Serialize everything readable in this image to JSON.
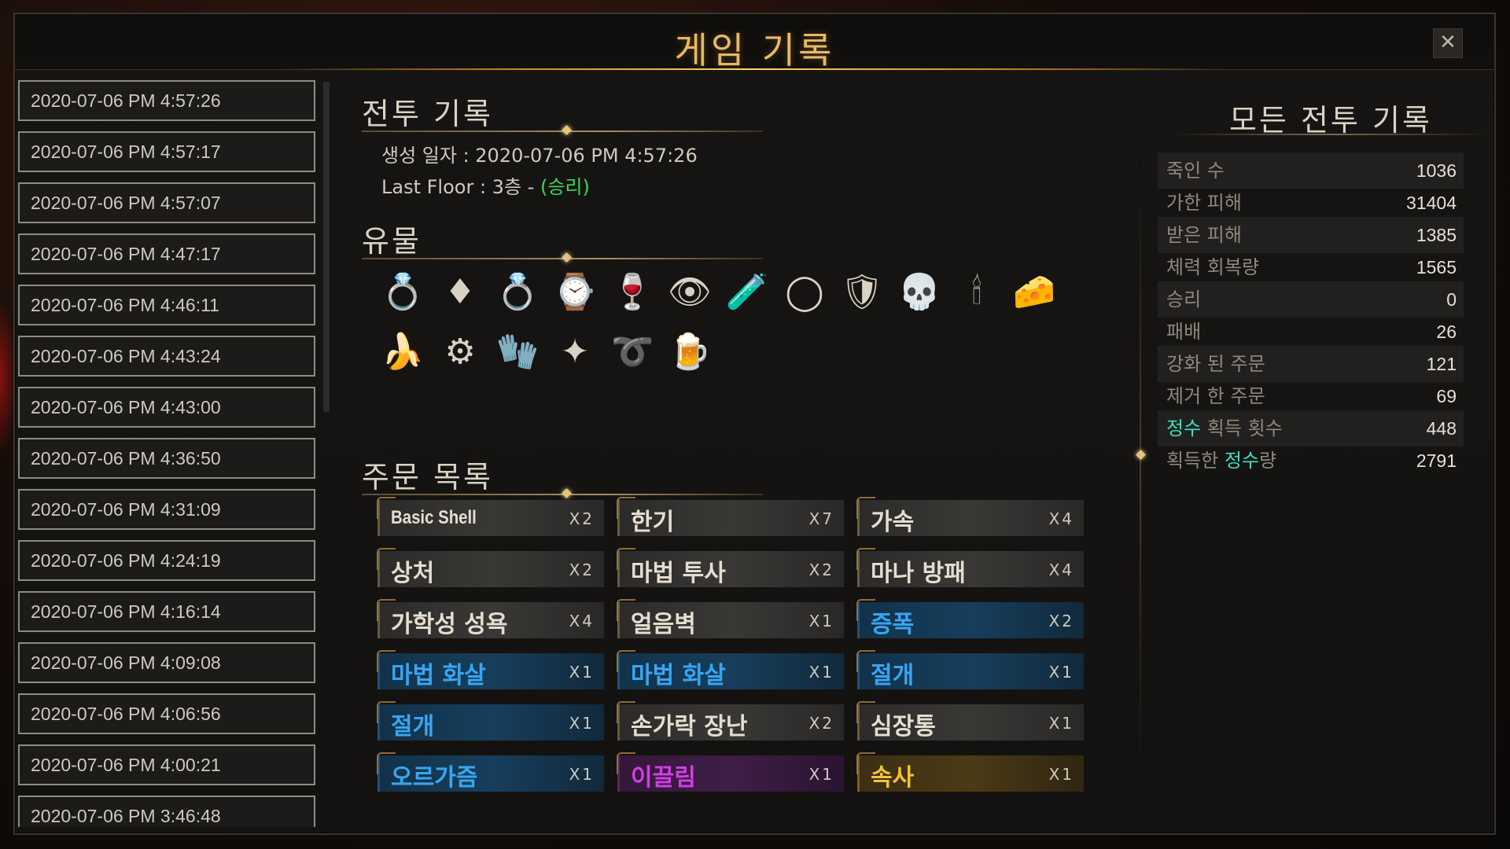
{
  "window": {
    "title": "게임 기록",
    "close_label": "✕"
  },
  "records": [
    "2020-07-06 PM 4:57:26",
    "2020-07-06 PM 4:57:17",
    "2020-07-06 PM 4:57:07",
    "2020-07-06 PM 4:47:17",
    "2020-07-06 PM 4:46:11",
    "2020-07-06 PM 4:43:24",
    "2020-07-06 PM 4:43:00",
    "2020-07-06 PM 4:36:50",
    "2020-07-06 PM 4:31:09",
    "2020-07-06 PM 4:24:19",
    "2020-07-06 PM 4:16:14",
    "2020-07-06 PM 4:09:08",
    "2020-07-06 PM 4:06:56",
    "2020-07-06 PM 4:00:21",
    "2020-07-06 PM 3:46:48"
  ],
  "battle": {
    "title": "전투 기록",
    "created_label": "생성 일자 : 2020-07-06 PM 4:57:26",
    "last_floor_label": "Last Floor : 3층 - ",
    "result": "(승리)"
  },
  "relics": {
    "title": "유물",
    "items": [
      {
        "icon": "silver-ring-icon",
        "glyph": "💍"
      },
      {
        "icon": "demon-emblem-icon",
        "glyph": "♦"
      },
      {
        "icon": "gem-ring-icon",
        "glyph": "💍"
      },
      {
        "icon": "pocket-watch-icon",
        "glyph": "⌚"
      },
      {
        "icon": "wine-glass-icon",
        "glyph": "🍷"
      },
      {
        "icon": "eye-staff-icon",
        "glyph": "👁"
      },
      {
        "icon": "potion-vial-icon",
        "glyph": "🧪"
      },
      {
        "icon": "purple-ring-icon",
        "glyph": "◯"
      },
      {
        "icon": "wooden-shield-icon",
        "glyph": "🛡"
      },
      {
        "icon": "skull-icon",
        "glyph": "💀"
      },
      {
        "icon": "candle-icon",
        "glyph": "🕯"
      },
      {
        "icon": "cheese-icon",
        "glyph": "🧀"
      },
      {
        "icon": "banana-icon",
        "glyph": "🍌"
      },
      {
        "icon": "gear-icon",
        "glyph": "⚙"
      },
      {
        "icon": "gauntlet-icon",
        "glyph": "🧤"
      },
      {
        "icon": "gold-ore-icon",
        "glyph": "✦"
      },
      {
        "icon": "rope-icon",
        "glyph": "➰"
      },
      {
        "icon": "mug-icon",
        "glyph": "🍺"
      }
    ]
  },
  "spells": {
    "title": "주문 목록",
    "items": [
      {
        "name": "Basic Shell",
        "count": "X2",
        "style": "gray",
        "en": true
      },
      {
        "name": "한기",
        "count": "X7",
        "style": "gray"
      },
      {
        "name": "가속",
        "count": "X4",
        "style": "gray"
      },
      {
        "name": "상처",
        "count": "X2",
        "style": "gray"
      },
      {
        "name": "마법 투사",
        "count": "X2",
        "style": "gray"
      },
      {
        "name": "마나 방패",
        "count": "X4",
        "style": "gray"
      },
      {
        "name": "가학성 성욕",
        "count": "X4",
        "style": "gray"
      },
      {
        "name": "얼음벽",
        "count": "X1",
        "style": "gray"
      },
      {
        "name": "증폭",
        "count": "X2",
        "style": "blue"
      },
      {
        "name": "마법 화살",
        "count": "X1",
        "style": "blue"
      },
      {
        "name": "마법 화살",
        "count": "X1",
        "style": "blue"
      },
      {
        "name": "절개",
        "count": "X1",
        "style": "blue"
      },
      {
        "name": "절개",
        "count": "X1",
        "style": "blue"
      },
      {
        "name": "손가락 장난",
        "count": "X2",
        "style": "gray"
      },
      {
        "name": "심장통",
        "count": "X1",
        "style": "gray"
      },
      {
        "name": "오르가즘",
        "count": "X1",
        "style": "blue"
      },
      {
        "name": "이끌림",
        "count": "X1",
        "style": "purple"
      },
      {
        "name": "속사",
        "count": "X1",
        "style": "gold"
      }
    ]
  },
  "stats": {
    "title": "모든 전투 기록",
    "rows": [
      {
        "label": "죽인 수",
        "value": "1036"
      },
      {
        "label": "가한 피해",
        "value": "31404"
      },
      {
        "label": "받은 피해",
        "value": "1385"
      },
      {
        "label": "체력 회복량",
        "value": "1565"
      },
      {
        "label": "승리",
        "value": "0"
      },
      {
        "label": "패배",
        "value": "26"
      },
      {
        "label": "강화 된 주문",
        "value": "121"
      },
      {
        "label": "제거 한 주문",
        "value": "69"
      },
      {
        "label_parts": [
          "정수",
          " 획득 횟수"
        ],
        "value": "448"
      },
      {
        "label_parts": [
          "획득한 ",
          "정수",
          "량"
        ],
        "value": "2791"
      }
    ]
  },
  "colors": {
    "title_gold": "#e8b865",
    "victory_green": "#3cd65a",
    "essence_cyan": "#3fe0c0",
    "spell_blue": "#38a6f2",
    "spell_purple": "#d13ee8",
    "spell_gold": "#f2c23a"
  }
}
